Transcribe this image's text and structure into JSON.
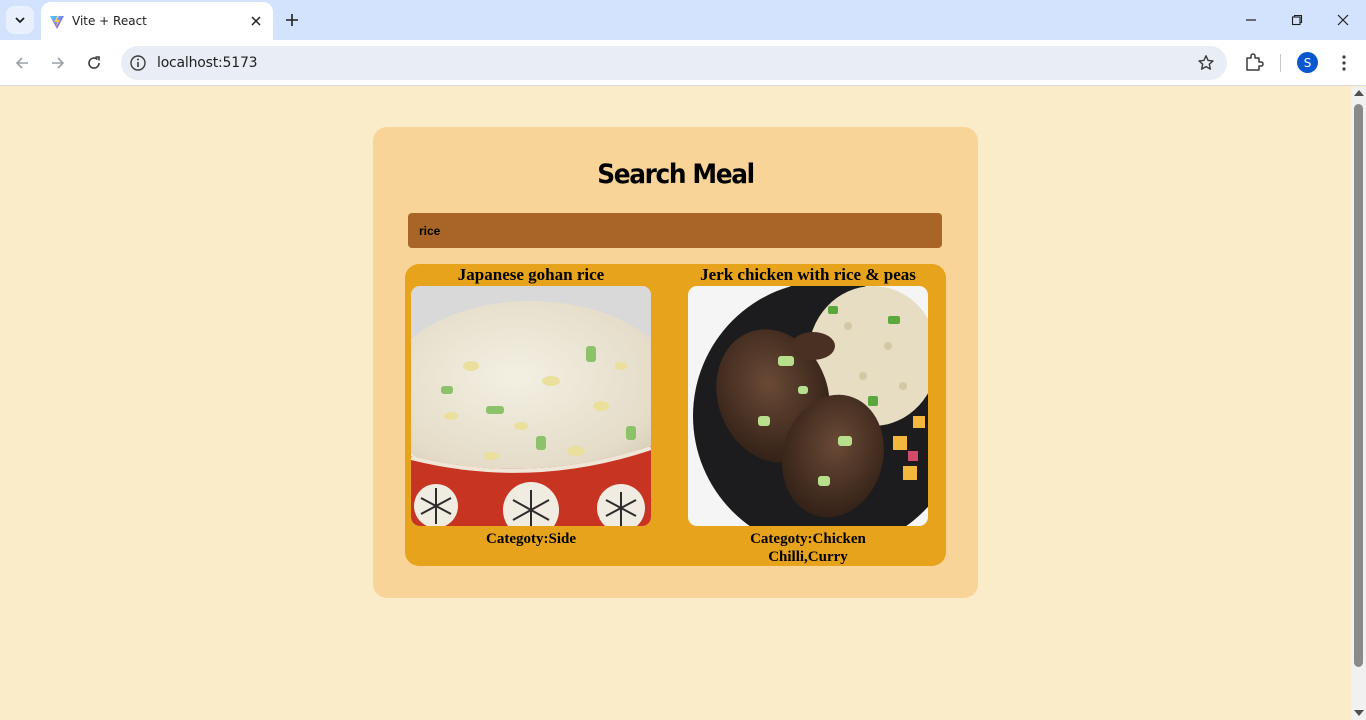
{
  "browser": {
    "tab_title": "Vite + React",
    "url": "localhost:5173",
    "profile_initial": "S",
    "accent": "#0b57d0"
  },
  "page": {
    "heading": "Search Meal",
    "search_value": "rice",
    "colors": {
      "background": "#faecc8",
      "card": "#f8d499",
      "search": "#a86527",
      "results": "#e6a31b"
    },
    "meals": [
      {
        "title": "Japanese gohan rice",
        "category": "Categoty:Side",
        "image": "fried-rice-bowl-image"
      },
      {
        "title": "Jerk chicken with rice & peas",
        "category": "Categoty:Chicken Chilli,Curry",
        "image": "jerk-chicken-plate-image"
      }
    ]
  }
}
